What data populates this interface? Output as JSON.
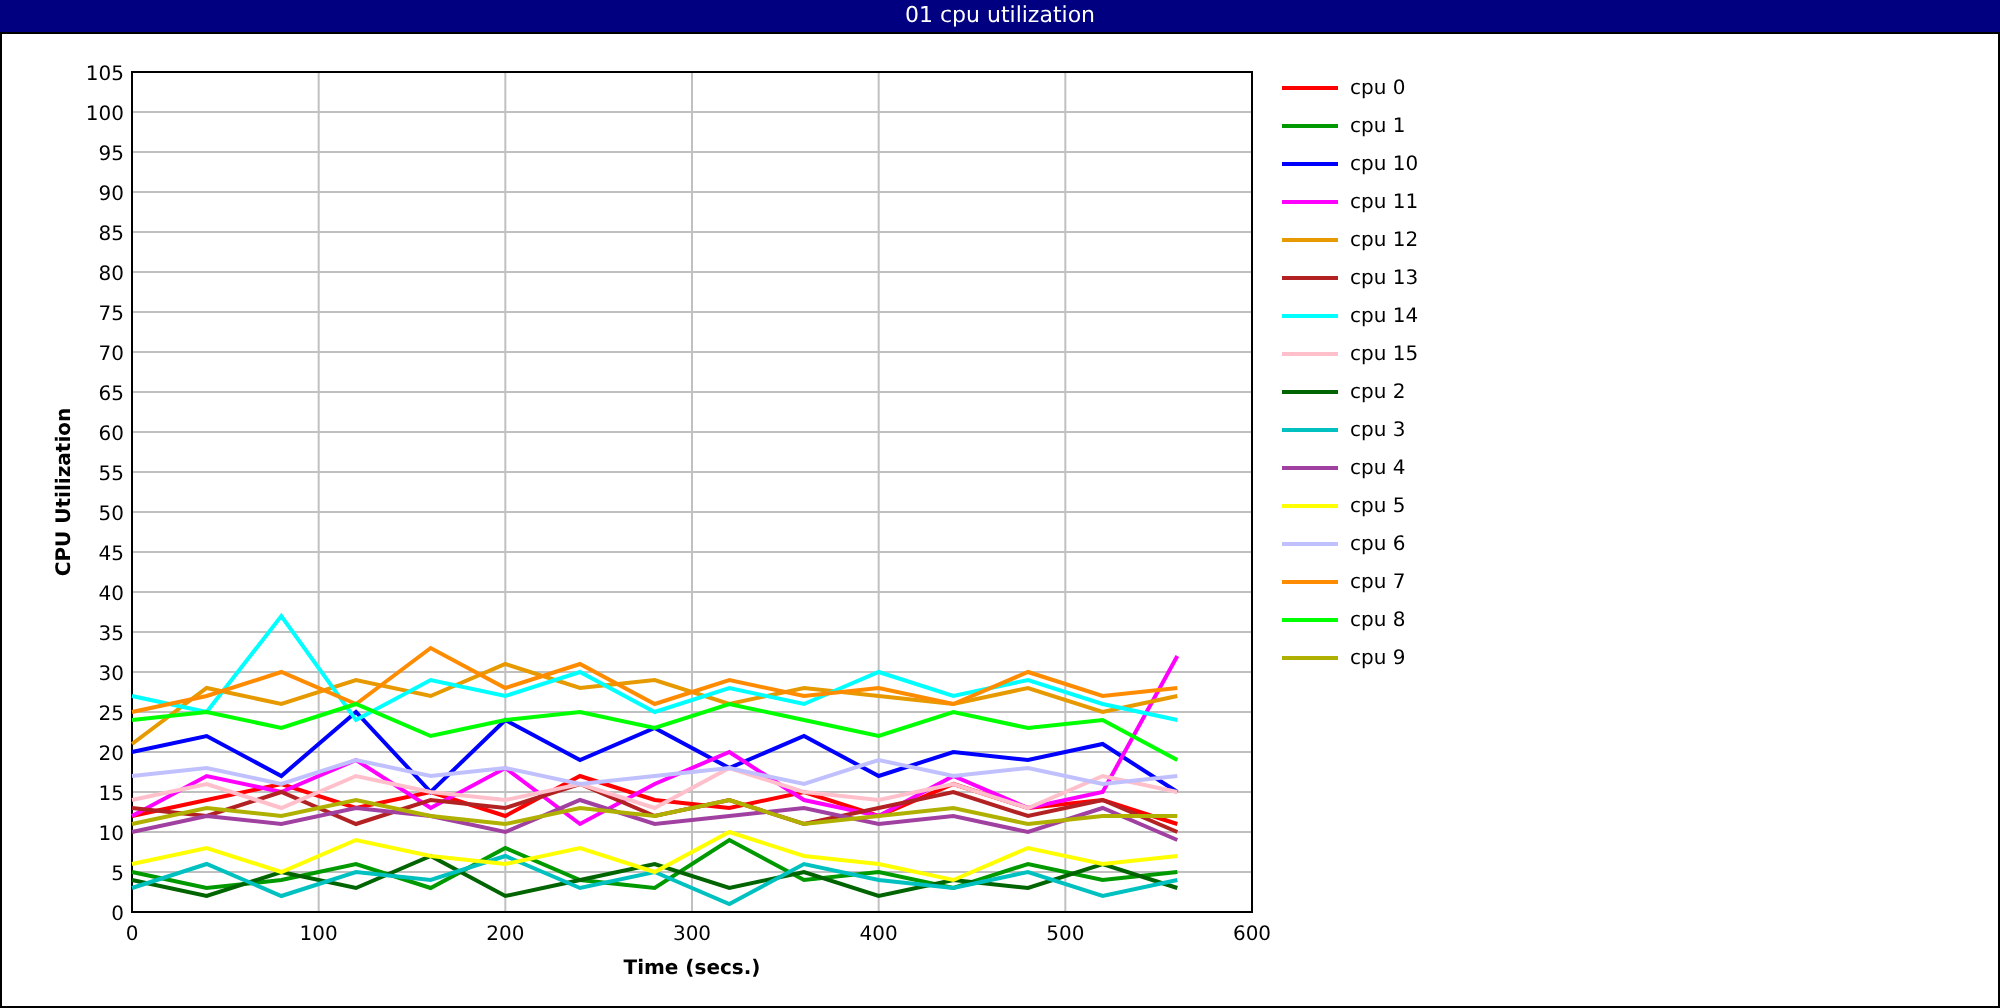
{
  "window": {
    "title": "01 cpu utilization"
  },
  "chart": {
    "chart_data": {
      "type": "line",
      "grid": true,
      "legend": true,
      "xlabel": "Time (secs.)",
      "ylabel": "CPU Utilization",
      "x": [
        0,
        40,
        80,
        120,
        160,
        200,
        240,
        280,
        320,
        360,
        400,
        440,
        480,
        520,
        560
      ],
      "xlim": [
        0,
        600
      ],
      "ylim": [
        0,
        105
      ],
      "xticks": [
        0,
        100,
        200,
        300,
        400,
        500,
        600
      ],
      "yticks": [
        0,
        5,
        10,
        15,
        20,
        25,
        30,
        35,
        40,
        45,
        50,
        55,
        60,
        65,
        70,
        75,
        80,
        85,
        90,
        95,
        100,
        105
      ],
      "series": [
        {
          "name": "cpu 0",
          "color": "#ff0000",
          "values": [
            12,
            14,
            16,
            13,
            15,
            12,
            17,
            14,
            13,
            15,
            12,
            16,
            13,
            14,
            11
          ]
        },
        {
          "name": "cpu 1",
          "color": "#009900",
          "values": [
            5,
            3,
            4,
            6,
            3,
            8,
            4,
            3,
            9,
            4,
            5,
            3,
            6,
            4,
            5
          ]
        },
        {
          "name": "cpu 10",
          "color": "#0000ff",
          "values": [
            20,
            22,
            17,
            25,
            15,
            24,
            19,
            23,
            18,
            22,
            17,
            20,
            19,
            21,
            15
          ]
        },
        {
          "name": "cpu 11",
          "color": "#ff00ff",
          "values": [
            12,
            17,
            15,
            19,
            13,
            18,
            11,
            16,
            20,
            14,
            12,
            17,
            13,
            15,
            32
          ]
        },
        {
          "name": "cpu 12",
          "color": "#e69a00",
          "values": [
            21,
            28,
            26,
            29,
            27,
            31,
            28,
            29,
            26,
            28,
            27,
            26,
            28,
            25,
            27
          ]
        },
        {
          "name": "cpu 13",
          "color": "#b22222",
          "values": [
            13,
            12,
            15,
            11,
            14,
            13,
            16,
            12,
            14,
            11,
            13,
            15,
            12,
            14,
            10
          ]
        },
        {
          "name": "cpu 14",
          "color": "#00ffff",
          "values": [
            27,
            25,
            37,
            24,
            29,
            27,
            30,
            25,
            28,
            26,
            30,
            27,
            29,
            26,
            24
          ]
        },
        {
          "name": "cpu 15",
          "color": "#ffc0cb",
          "values": [
            14,
            16,
            13,
            17,
            15,
            14,
            16,
            13,
            18,
            15,
            14,
            16,
            13,
            17,
            15
          ]
        },
        {
          "name": "cpu 2",
          "color": "#006400",
          "values": [
            4,
            2,
            5,
            3,
            7,
            2,
            4,
            6,
            3,
            5,
            2,
            4,
            3,
            6,
            3
          ]
        },
        {
          "name": "cpu 3",
          "color": "#00c0c0",
          "values": [
            3,
            6,
            2,
            5,
            4,
            7,
            3,
            5,
            1,
            6,
            4,
            3,
            5,
            2,
            4
          ]
        },
        {
          "name": "cpu 4",
          "color": "#a040a0",
          "values": [
            10,
            12,
            11,
            13,
            12,
            10,
            14,
            11,
            12,
            13,
            11,
            12,
            10,
            13,
            9
          ]
        },
        {
          "name": "cpu 5",
          "color": "#ffff00",
          "values": [
            6,
            8,
            5,
            9,
            7,
            6,
            8,
            5,
            10,
            7,
            6,
            4,
            8,
            6,
            7
          ]
        },
        {
          "name": "cpu 6",
          "color": "#c0c0ff",
          "values": [
            17,
            18,
            16,
            19,
            17,
            18,
            16,
            17,
            18,
            16,
            19,
            17,
            18,
            16,
            17
          ]
        },
        {
          "name": "cpu 7",
          "color": "#ff8c00",
          "values": [
            25,
            27,
            30,
            26,
            33,
            28,
            31,
            26,
            29,
            27,
            28,
            26,
            30,
            27,
            28
          ]
        },
        {
          "name": "cpu 8",
          "color": "#00ff00",
          "values": [
            24,
            25,
            23,
            26,
            22,
            24,
            25,
            23,
            26,
            24,
            22,
            25,
            23,
            24,
            19
          ]
        },
        {
          "name": "cpu 9",
          "color": "#b0b000",
          "values": [
            11,
            13,
            12,
            14,
            12,
            11,
            13,
            12,
            14,
            11,
            12,
            13,
            11,
            12,
            12
          ]
        }
      ]
    }
  }
}
